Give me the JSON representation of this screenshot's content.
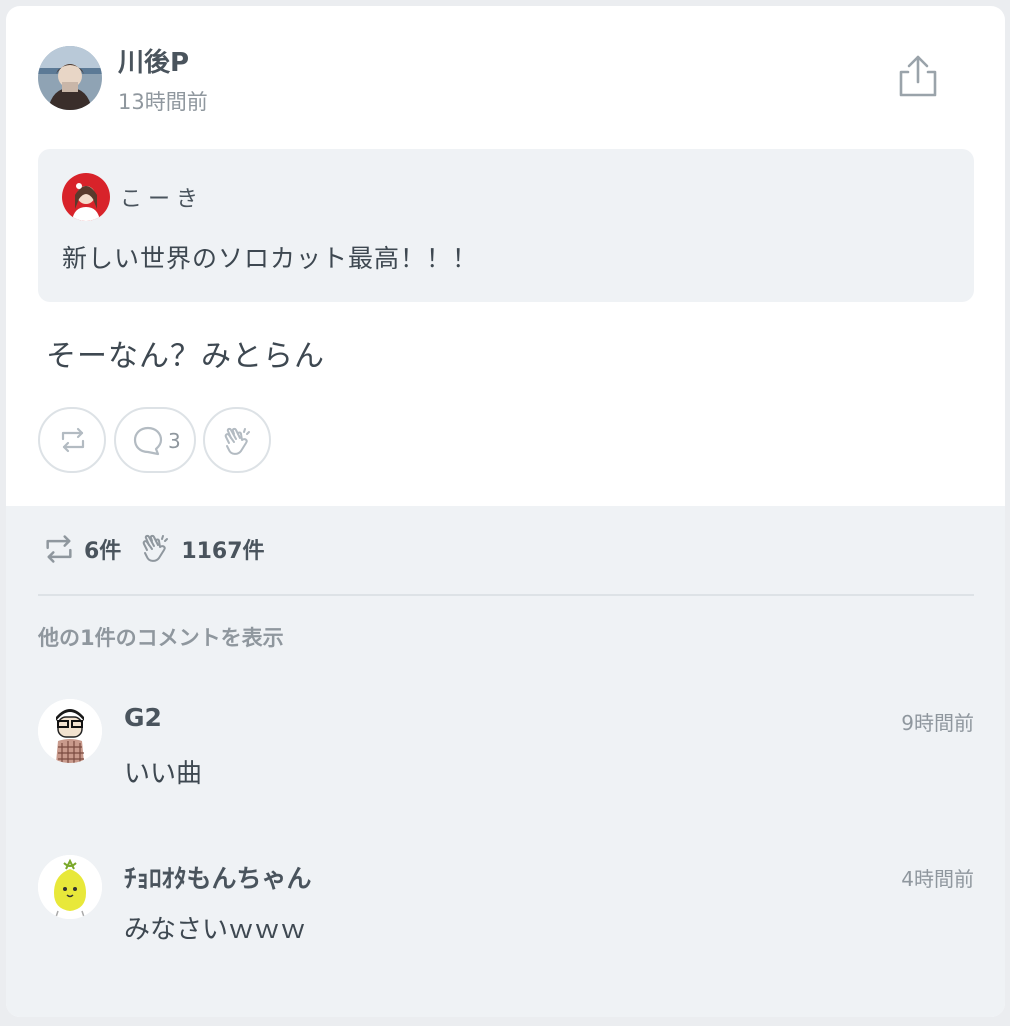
{
  "post": {
    "author": "川後P",
    "time": "13時間前",
    "avatar_icon": "user-avatar-icon",
    "share_icon": "share-icon"
  },
  "quote": {
    "author": "こーき",
    "text": "新しい世界のソロカット最高！！！"
  },
  "body": "そーなん？みとらん",
  "actions": {
    "repost_icon": "repost-icon",
    "comment_icon": "comment-icon",
    "comment_count": "3",
    "clap_icon": "clap-icon"
  },
  "stats": {
    "reposts": "6件",
    "claps": "1167件"
  },
  "more_comments": "他の1件のコメントを表示",
  "comments": [
    {
      "name": "G2",
      "time": "9時間前",
      "text": "いい曲"
    },
    {
      "name": "ﾁｮﾛｵﾀもんちゃん",
      "time": "4時間前",
      "text": "みなさいｗｗｗ"
    }
  ],
  "colors": {
    "card": "#ffffff",
    "panel": "#eff2f5",
    "text": "#3e4851",
    "muted": "#8f979e",
    "border": "#dde2e6"
  }
}
